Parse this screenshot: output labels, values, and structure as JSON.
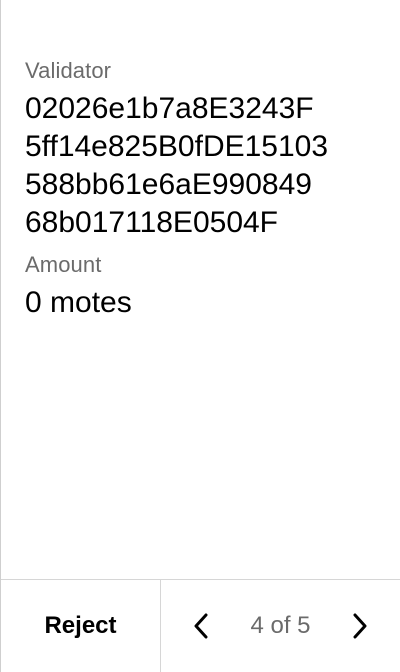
{
  "fields": {
    "validator": {
      "label": "Validator",
      "lines": [
        "02026e1b7a8E3243F",
        "5ff14e825B0fDE15103",
        "588bb61e6aE990849",
        "68b017118E0504F"
      ]
    },
    "amount": {
      "label": "Amount",
      "value": "0 motes"
    }
  },
  "footer": {
    "reject_label": "Reject",
    "page_indicator": "4 of 5",
    "prev_icon": "chevron-left-icon",
    "next_icon": "chevron-right-icon"
  },
  "colors": {
    "background": "#ffffff",
    "text_primary": "#000000",
    "text_secondary": "#6b6b6b",
    "divider": "#d6d6d6"
  }
}
